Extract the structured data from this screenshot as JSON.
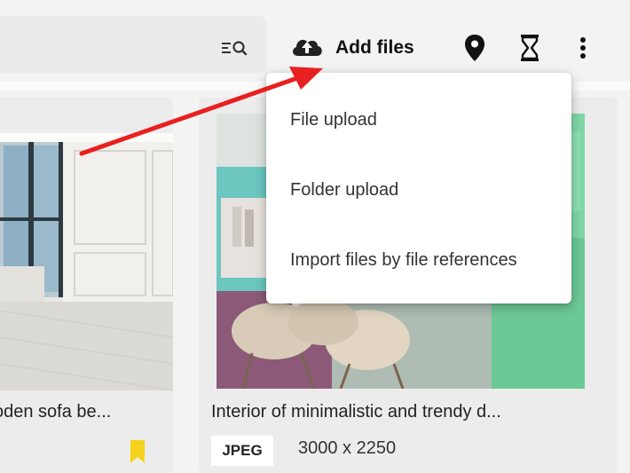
{
  "toolbar": {
    "add_files_label": "Add files",
    "icons": {
      "filter_search": "filter-search-icon",
      "upload": "cloud-upload-icon",
      "location": "location-pin-icon",
      "hourglass": "hourglass-icon",
      "more": "more-vertical-icon"
    }
  },
  "add_files_menu": {
    "items": [
      {
        "label": "File upload"
      },
      {
        "label": "Folder upload"
      },
      {
        "label": "Import files by file references"
      }
    ]
  },
  "cards": [
    {
      "title": "oden sofa be...",
      "bookmarked": true,
      "bookmark_color": "#f4d31a"
    },
    {
      "title": "Interior of minimalistic and trendy d...",
      "format": "JPEG",
      "dimensions": "3000 x 2250"
    }
  ],
  "annotation": {
    "arrow_color": "#e8201f"
  }
}
